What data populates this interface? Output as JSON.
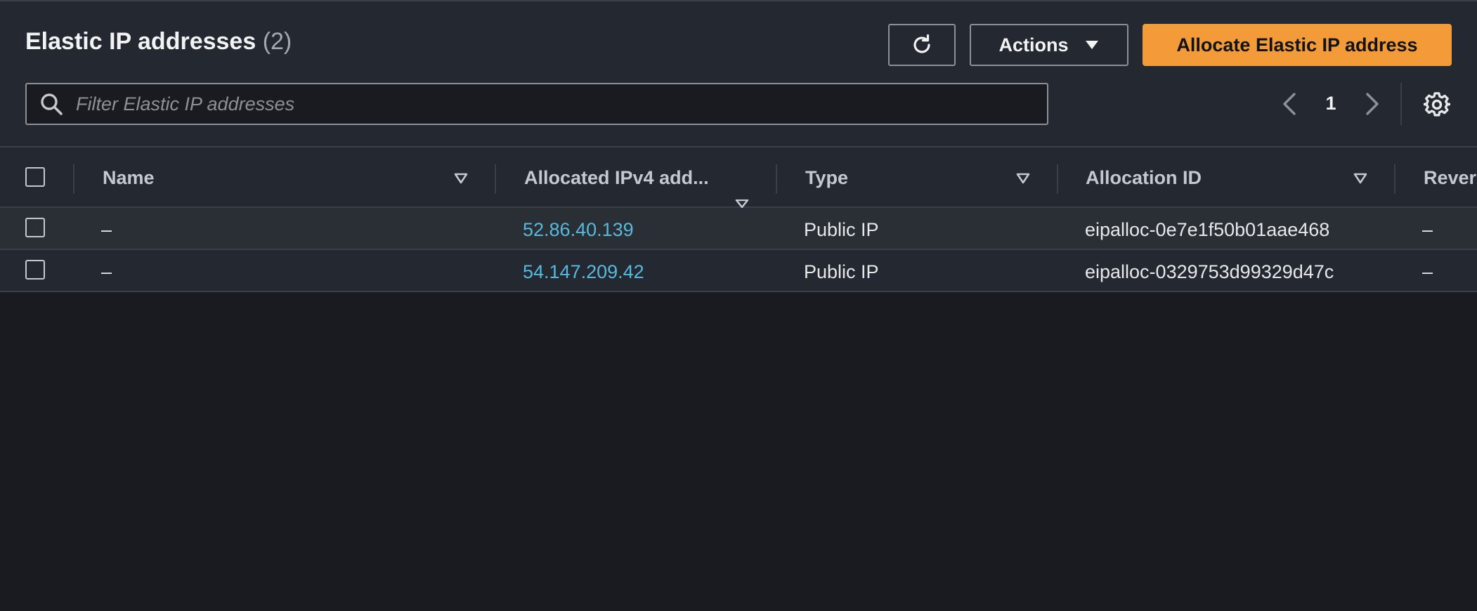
{
  "header": {
    "title": "Elastic IP addresses",
    "count": "(2)"
  },
  "toolbar": {
    "refresh_icon": "refresh-icon",
    "actions_label": "Actions",
    "allocate_label": "Allocate Elastic IP address",
    "primary_color": "#f29b38"
  },
  "filter": {
    "placeholder": "Filter Elastic IP addresses",
    "value": ""
  },
  "pagination": {
    "current_page": "1"
  },
  "table": {
    "columns": [
      {
        "label": "Name"
      },
      {
        "label": "Allocated IPv4 add..."
      },
      {
        "label": "Type"
      },
      {
        "label": "Allocation ID"
      },
      {
        "label": "Revers"
      }
    ],
    "rows": [
      {
        "name": "–",
        "ipv4": "52.86.40.139",
        "type": "Public IP",
        "allocation_id": "eipalloc-0e7e1f50b01aae468",
        "reverse_dns": "–"
      },
      {
        "name": "–",
        "ipv4": "54.147.209.42",
        "type": "Public IP",
        "allocation_id": "eipalloc-0329753d99329d47c",
        "reverse_dns": "–"
      }
    ]
  },
  "colors": {
    "link": "#56b9dd",
    "panel": "#232831",
    "background": "#191b20"
  }
}
